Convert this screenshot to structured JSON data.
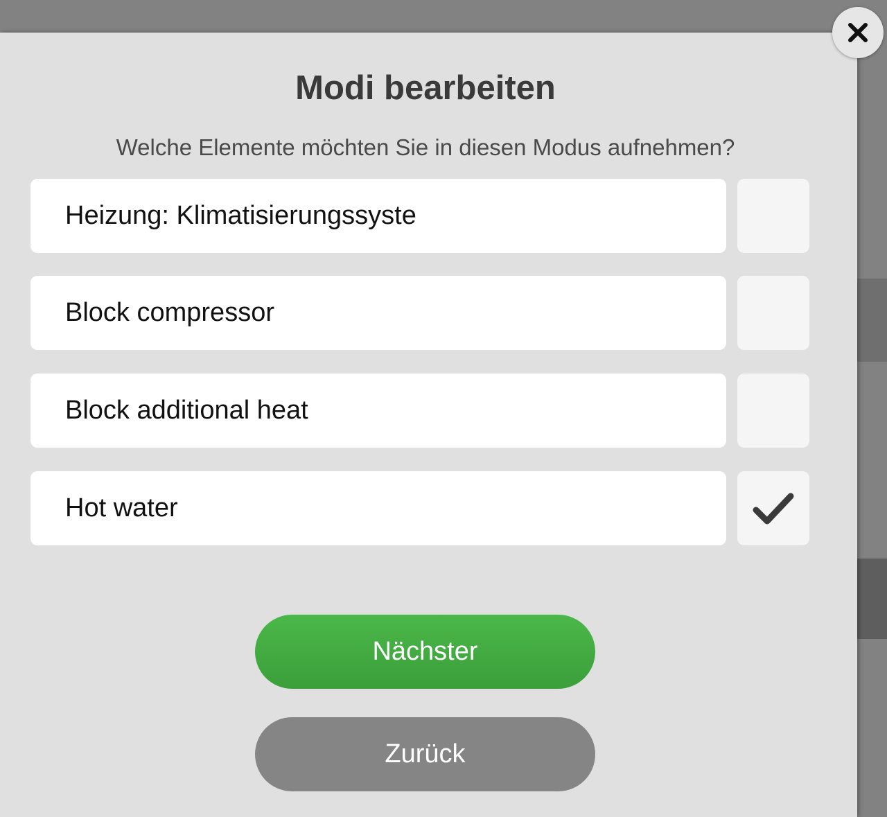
{
  "dialog": {
    "title": "Modi bearbeiten",
    "subtitle": "Welche Elemente möchten Sie in diesen Modus aufnehmen?",
    "close_icon": "close-icon"
  },
  "items": [
    {
      "label": "Heizung: Klimatisierungssyste",
      "checked": false
    },
    {
      "label": "Block compressor",
      "checked": false
    },
    {
      "label": "Block additional heat",
      "checked": false
    },
    {
      "label": "Hot water",
      "checked": true
    }
  ],
  "buttons": {
    "next_label": "Nächster",
    "back_label": "Zurück"
  },
  "colors": {
    "accent_green": "#45ad43",
    "secondary_gray": "#858585",
    "modal_bg": "#e0e0e0"
  }
}
